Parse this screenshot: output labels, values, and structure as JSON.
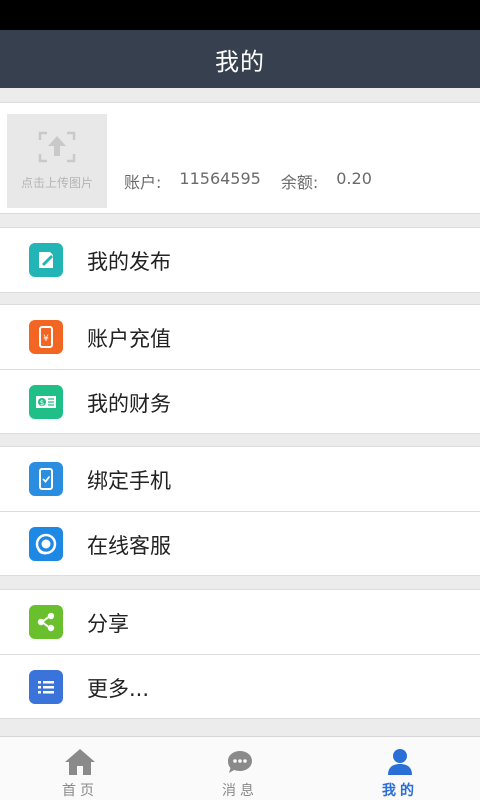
{
  "header": {
    "title": "我的"
  },
  "profile": {
    "upload_label": "点击上传图片",
    "account_label": "账户:",
    "account_value": "11564595",
    "balance_label": "余额:",
    "balance_value": "0.20"
  },
  "menu": {
    "publish": {
      "label": "我的发布",
      "icon": "publish-icon",
      "color": "#23b5b5"
    },
    "recharge": {
      "label": "账户充值",
      "icon": "phone-recharge-icon",
      "color": "#f26522"
    },
    "finance": {
      "label": "我的财务",
      "icon": "money-icon",
      "color": "#1fbf87"
    },
    "bind_phone": {
      "label": "绑定手机",
      "icon": "phone-check-icon",
      "color": "#2a8de0"
    },
    "service": {
      "label": "在线客服",
      "icon": "headset-icon",
      "color": "#1e88e5"
    },
    "share": {
      "label": "分享",
      "icon": "share-icon",
      "color": "#6abf2c"
    },
    "more": {
      "label": "更多...",
      "icon": "list-icon",
      "color": "#3a73d9"
    }
  },
  "tabs": [
    {
      "label": "首页",
      "icon": "home-icon",
      "active": false
    },
    {
      "label": "消息",
      "icon": "message-icon",
      "active": false
    },
    {
      "label": "我的",
      "icon": "user-icon",
      "active": true
    }
  ],
  "colors": {
    "title_bar": "#36404f",
    "active_tab": "#2a6fd6"
  }
}
